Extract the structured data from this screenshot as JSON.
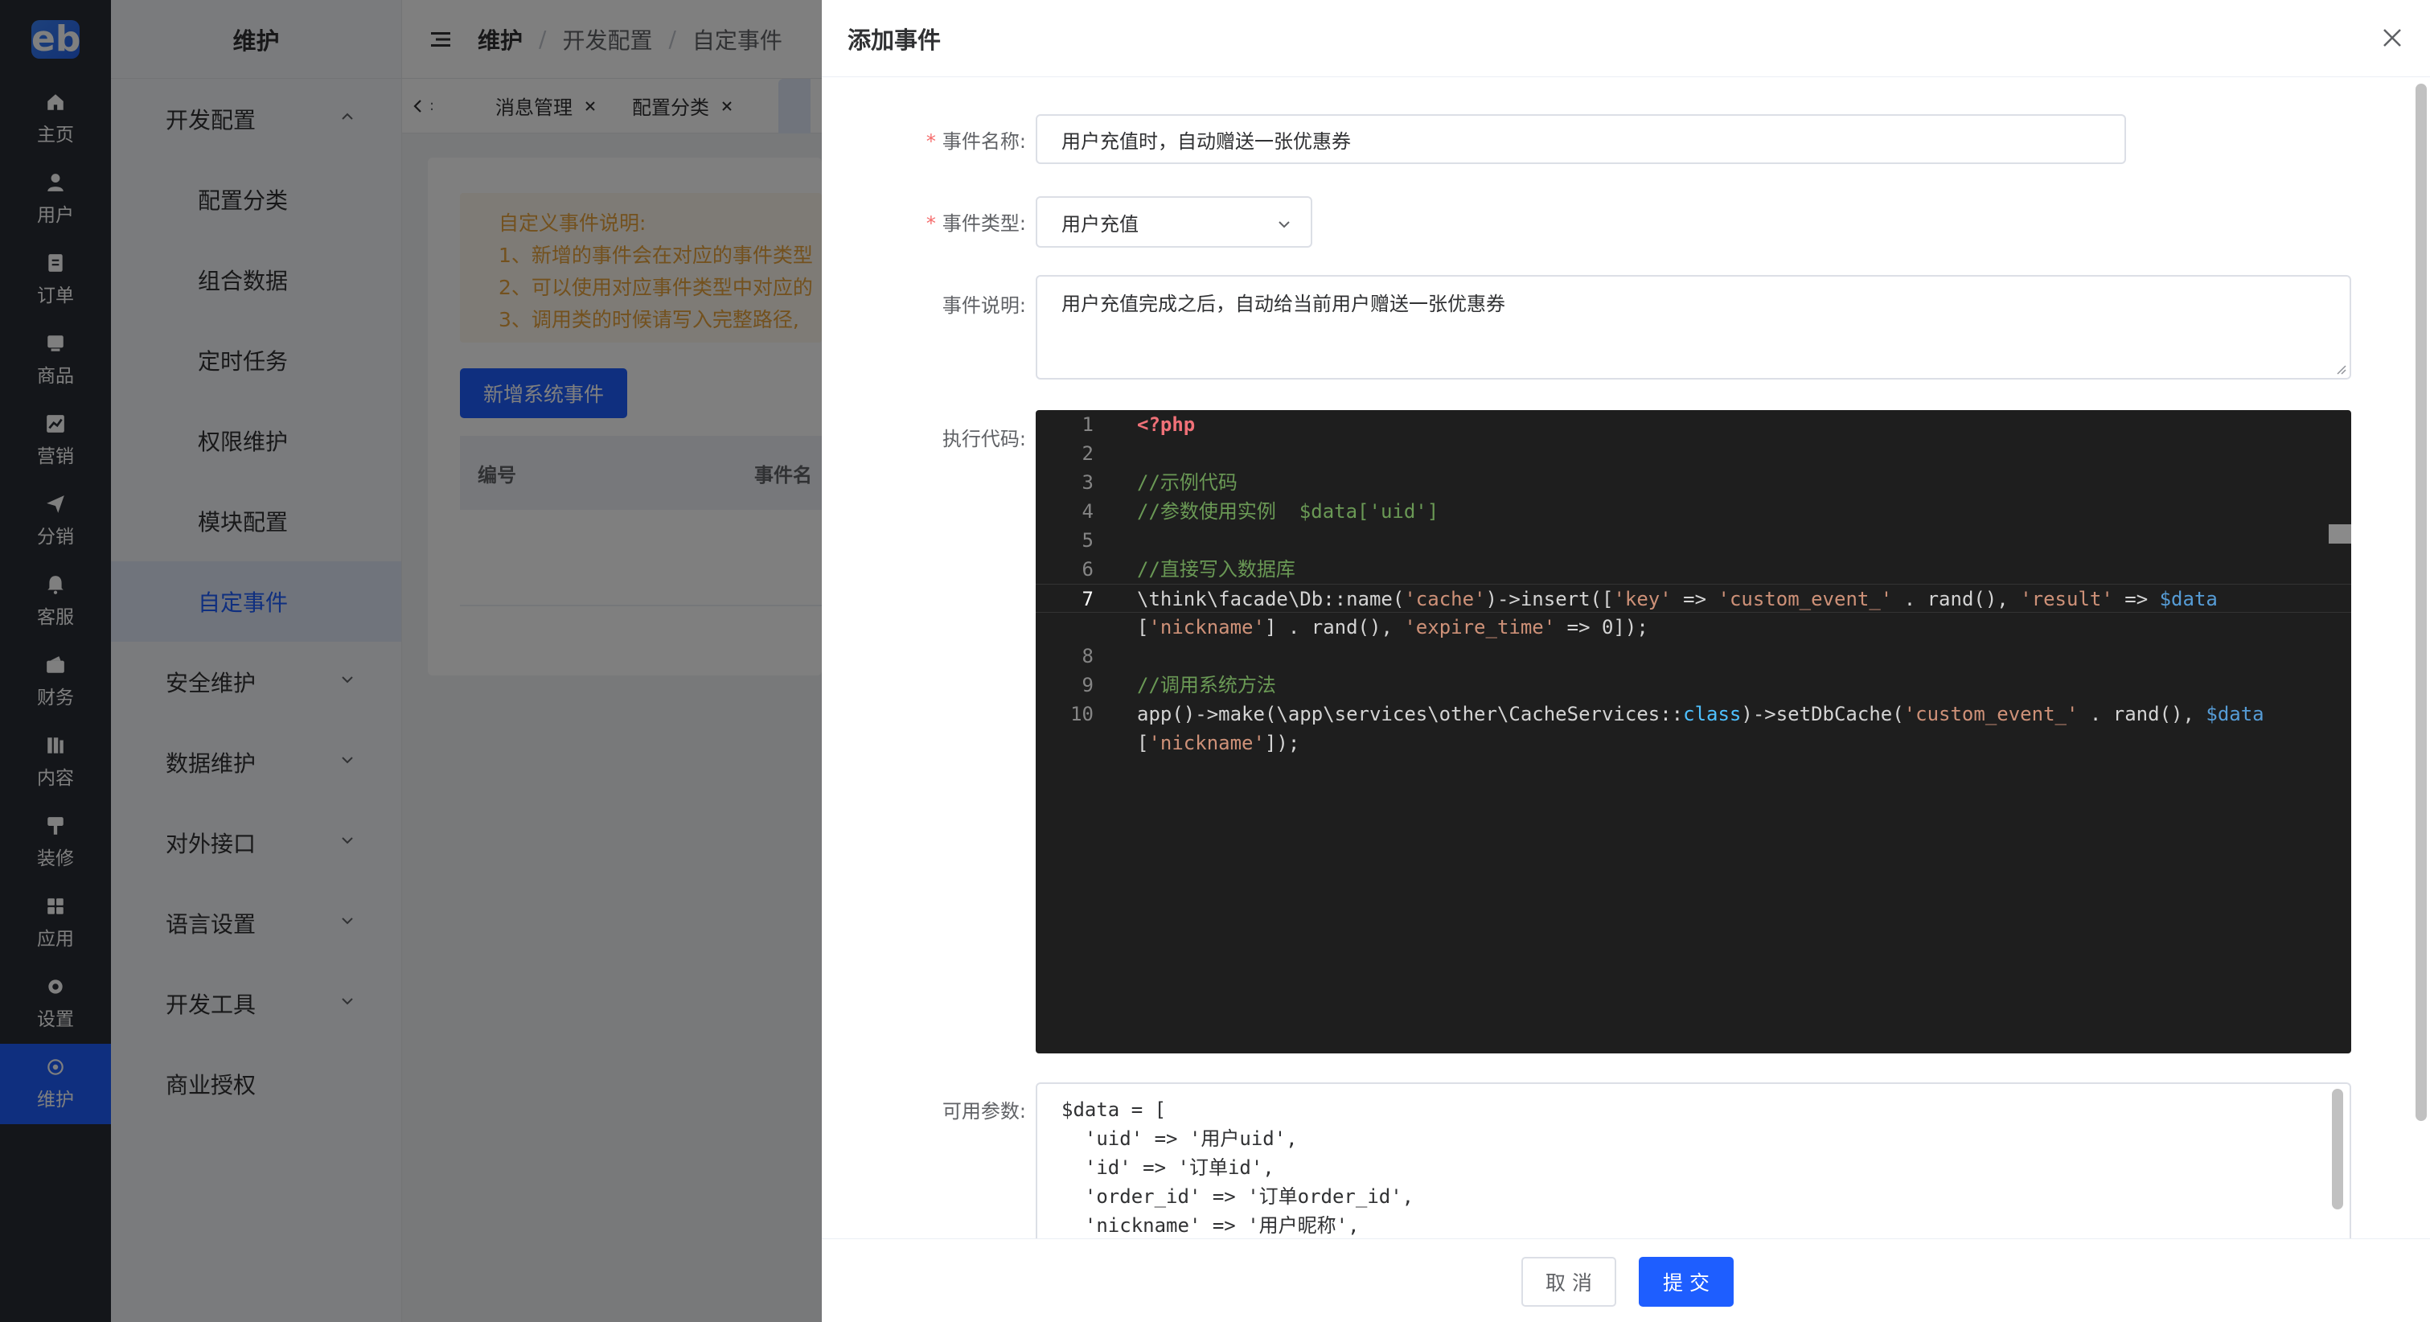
{
  "rail": {
    "logo": "eb",
    "items": [
      {
        "label": "主页",
        "icon": "home-icon"
      },
      {
        "label": "用户",
        "icon": "user-icon"
      },
      {
        "label": "订单",
        "icon": "order-icon"
      },
      {
        "label": "商品",
        "icon": "product-icon"
      },
      {
        "label": "营销",
        "icon": "marketing-icon"
      },
      {
        "label": "分销",
        "icon": "distribution-icon"
      },
      {
        "label": "客服",
        "icon": "service-icon"
      },
      {
        "label": "财务",
        "icon": "finance-icon"
      },
      {
        "label": "内容",
        "icon": "content-icon"
      },
      {
        "label": "装修",
        "icon": "decorate-icon"
      },
      {
        "label": "应用",
        "icon": "apps-icon"
      },
      {
        "label": "设置",
        "icon": "settings-icon"
      },
      {
        "label": "维护",
        "icon": "maintenance-icon"
      }
    ]
  },
  "sidebar": {
    "title": "维护",
    "items": [
      {
        "label": "开发配置"
      },
      {
        "label": "配置分类"
      },
      {
        "label": "组合数据"
      },
      {
        "label": "定时任务"
      },
      {
        "label": "权限维护"
      },
      {
        "label": "模块配置"
      },
      {
        "label": "自定事件"
      },
      {
        "label": "安全维护"
      },
      {
        "label": "数据维护"
      },
      {
        "label": "对外接口"
      },
      {
        "label": "语言设置"
      },
      {
        "label": "开发工具"
      },
      {
        "label": "商业授权"
      }
    ]
  },
  "header": {
    "breadcrumb": [
      "维护",
      "开发配置",
      "自定事件"
    ]
  },
  "tabs": [
    {
      "label": "消息管理"
    },
    {
      "label": "配置分类"
    }
  ],
  "main": {
    "notice": [
      "自定义事件说明:",
      "1、新增的事件会在对应的事件类型",
      "2、可以使用对应事件类型中对应的",
      "3、调用类的时候请写入完整路径,"
    ],
    "add_button": "新增系统事件",
    "table_headers": [
      "编号",
      "事件名"
    ]
  },
  "drawer": {
    "title": "添加事件",
    "fields": {
      "name_label": "事件名称:",
      "name_value": "用户充值时，自动赠送一张优惠券",
      "type_label": "事件类型:",
      "type_value": "用户充值",
      "desc_label": "事件说明:",
      "desc_value": "用户充值完成之后，自动给当前用户赠送一张优惠券",
      "code_label": "执行代码:",
      "params_label": "可用参数:"
    },
    "code": {
      "line_numbers": [
        "1",
        "2",
        "3",
        "4",
        "5",
        "6",
        "7",
        "",
        "8",
        "9",
        "10",
        ""
      ],
      "l1": "<?php",
      "l3": "//示例代码",
      "l4": "//参数使用实例  $data['uid']",
      "l6": "//直接写入数据库",
      "l7a": "\\think\\facade\\Db::name(",
      "l7b": "'cache'",
      "l7c": ")->insert([",
      "l7d": "'key'",
      "l7e": " => ",
      "l7f": "'custom_event_'",
      "l7g": " . rand(), ",
      "l7h": "'result'",
      "l7i": " => ",
      "l7j": "$data",
      "l7k": "[",
      "l7l": "'nickname'",
      "l7m": "] . rand(), ",
      "l7n": "'expire_time'",
      "l7o": " => 0]);",
      "l9": "//调用系统方法",
      "l10a": "app()->make(\\app\\services\\other\\CacheServices::",
      "l10b": "class",
      "l10c": ")->setDbCache(",
      "l10d": "'custom_event_'",
      "l10e": " . rand(), ",
      "l10f": "$data",
      "l10g": "[",
      "l10h": "'nickname'",
      "l10i": "]);"
    },
    "params": [
      "$data = [",
      "  'uid' => '用户uid',",
      "  'id' => '订单id',",
      "  'order_id' => '订单order_id',",
      "  'nickname' => '用户昵称',"
    ],
    "cancel_label": "取 消",
    "submit_label": "提 交"
  },
  "colors": {
    "primary": "#1e5eff",
    "rail_bg": "#282c34",
    "editor_bg": "#1e1e1e",
    "required": "#f56c6c",
    "notice_text": "#e6a23c"
  }
}
